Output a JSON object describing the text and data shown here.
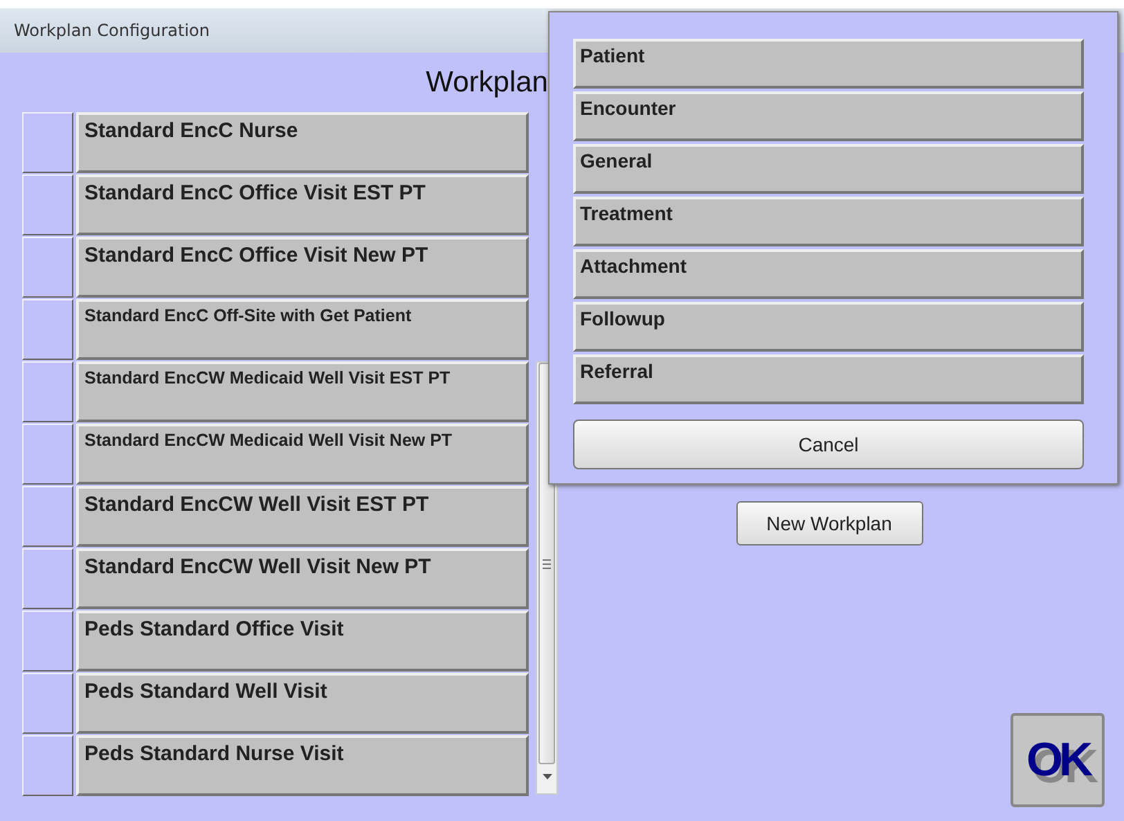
{
  "window": {
    "title": "Workplan Configuration"
  },
  "heading": "Workplan",
  "workplans": [
    {
      "label": "Standard EncC Nurse"
    },
    {
      "label": "Standard EncC Office Visit EST PT"
    },
    {
      "label": "Standard EncC Office Visit New PT"
    },
    {
      "label": "Standard EncC Off-Site with Get Patient"
    },
    {
      "label": "Standard EncCW Medicaid Well Visit EST PT"
    },
    {
      "label": "Standard EncCW Medicaid Well Visit New PT"
    },
    {
      "label": "Standard EncCW Well Visit EST PT"
    },
    {
      "label": "Standard EncCW Well Visit New PT"
    },
    {
      "label": "Peds Standard Office Visit"
    },
    {
      "label": "Peds Standard Well Visit"
    },
    {
      "label": "Peds Standard Nurse Visit"
    }
  ],
  "new_button": "New Workplan",
  "ok_button": "OK",
  "popup": {
    "items": [
      "Patient",
      "Encounter",
      "General",
      "Treatment",
      "Attachment",
      "Followup",
      "Referral"
    ],
    "cancel": "Cancel"
  }
}
